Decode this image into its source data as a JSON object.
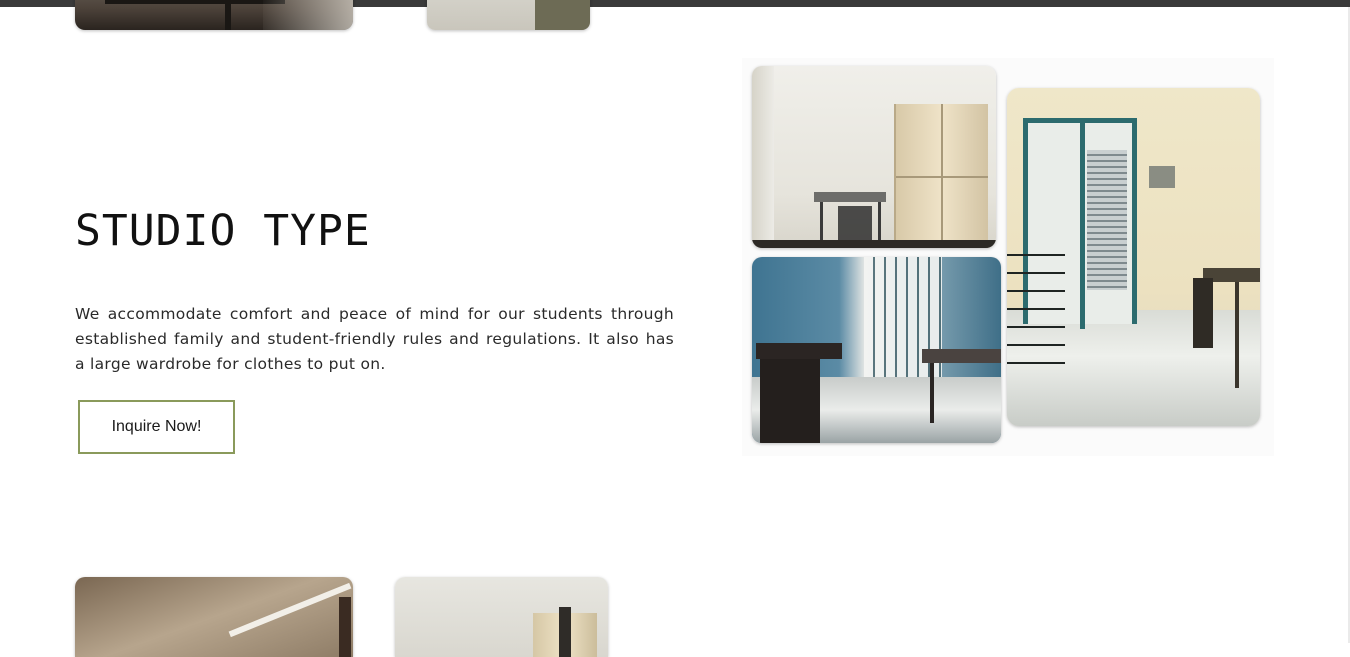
{
  "section": {
    "title": "STUDIO TYPE",
    "description": "We accommodate comfort and peace of mind for our students through established family and student-friendly rules and regulations. It also has a large wardrobe for clothes to put on.",
    "cta_label": "Inquire Now!"
  },
  "colors": {
    "top_bar": "#3a3a3a",
    "button_border": "#8a9a5b",
    "heading_text": "#111111",
    "body_text": "#2a2a2a"
  }
}
